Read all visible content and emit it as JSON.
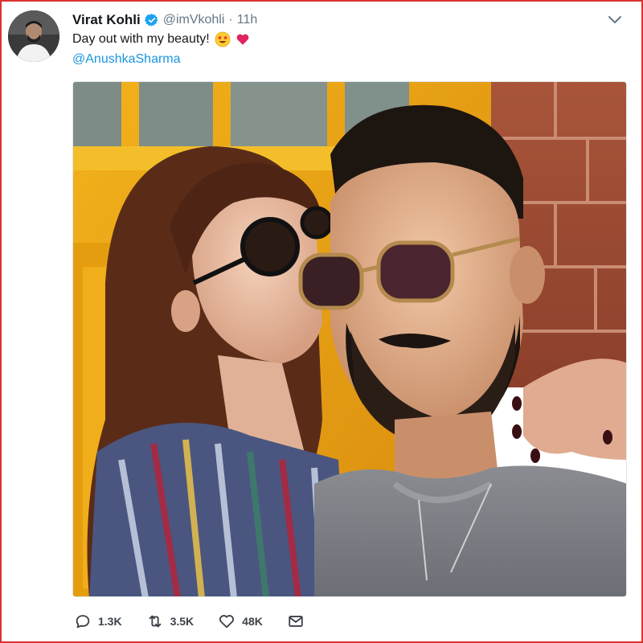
{
  "user": {
    "display_name": "Virat Kohli",
    "handle": "@imVkohli",
    "separator": "·",
    "time": "11h"
  },
  "tweet": {
    "text": "Day out with my beauty!",
    "emojis": [
      "star-struck-emoji",
      "red-heart-emoji"
    ],
    "mention": "@AnushkaSharma"
  },
  "actions": {
    "reply": {
      "icon": "reply-icon",
      "count": "1.3K"
    },
    "retweet": {
      "icon": "retweet-icon",
      "count": "3.5K"
    },
    "like": {
      "icon": "heart-icon",
      "count": "48K"
    },
    "dm": {
      "icon": "envelope-icon"
    }
  },
  "colors": {
    "border": "#d9322f",
    "link": "#1b95e0",
    "verified": "#1da1f2",
    "text": "#14171a",
    "muted": "#657786"
  }
}
